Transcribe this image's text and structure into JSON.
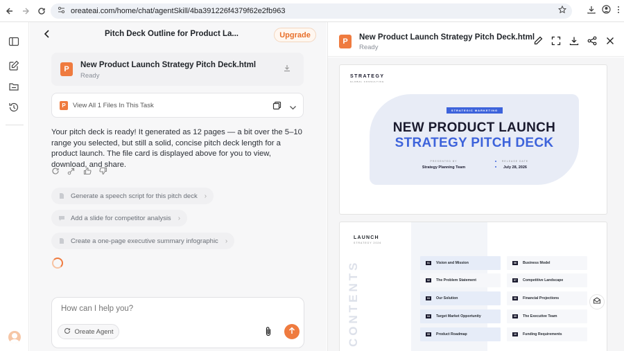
{
  "browser": {
    "url": "oreateai.com/home/chat/agentSkill/4ba391226f4379f62e2fb963"
  },
  "chat": {
    "title": "Pitch Deck Outline for Product La...",
    "upgrade_label": "Upgrade",
    "file_card": {
      "icon_letter": "P",
      "name": "New Product Launch Strategy Pitch Deck.html",
      "status": "Ready"
    },
    "files_row": {
      "icon_letter": "P",
      "label": "View All 1 Files In This Task"
    },
    "message": "Your pitch deck is ready! It generated as 12 pages — a bit over the 5–10 range you selected, but still a solid, concise pitch deck length for a product launch. The file card is displayed above for you to view, download, and share.",
    "suggestions": [
      {
        "label": "Generate a speech script for this pitch deck"
      },
      {
        "label": "Add a slide for competitor analysis"
      },
      {
        "label": "Create a one-page executive summary infographic"
      }
    ],
    "input_placeholder": "How can I help you?",
    "agent_button": "Oreate Agent"
  },
  "preview": {
    "icon_letter": "P",
    "name": "New Product Launch Strategy Pitch Deck.html",
    "status": "Ready",
    "slide1": {
      "brand": "STRATEGY",
      "brand_sub": "GLOBAL CONSULTING",
      "tag": "STRATEGIC MARKETING",
      "title_line1": "NEW PRODUCT LAUNCH",
      "title_line2": "STRATEGY PITCH DECK",
      "presented_by_label": "PRESENTED BY",
      "presented_by": "Strategy Planning Team",
      "release_date_label": "RELEASE DATE",
      "release_date": "July 28, 2026"
    },
    "slide2": {
      "brand": "LAUNCH",
      "brand_sub": "STRATEGY 2026",
      "side_label": "CONTENTS",
      "toc_left": [
        {
          "num": "01",
          "label": "Vision and Mission"
        },
        {
          "num": "02",
          "label": "The Problem Statement"
        },
        {
          "num": "03",
          "label": "Our Solution"
        },
        {
          "num": "04",
          "label": "Target Market Opportunity"
        },
        {
          "num": "05",
          "label": "Product Roadmap"
        }
      ],
      "toc_right": [
        {
          "num": "06",
          "label": "Business Model"
        },
        {
          "num": "07",
          "label": "Competitive Landscape"
        },
        {
          "num": "08",
          "label": "Financial Projections"
        },
        {
          "num": "09",
          "label": "The Executive Team"
        },
        {
          "num": "10",
          "label": "Funding Requirements"
        }
      ]
    }
  },
  "colors": {
    "accent": "#ef7b3f",
    "deck_blue": "#3d63db",
    "deck_navy": "#1a1a2e"
  },
  "icons": [
    "back-arrow-icon",
    "forward-arrow-icon",
    "reload-icon",
    "site-info-icon",
    "star-icon",
    "download-icon",
    "profile-icon",
    "menu-dots-icon",
    "sidebar-toggle-icon",
    "new-chat-icon",
    "folder-icon",
    "history-icon",
    "chevron-left-icon",
    "ppt-file-icon",
    "copy-icon",
    "chevron-down-icon",
    "regenerate-icon",
    "share-icon",
    "thumbs-up-icon",
    "thumbs-down-icon",
    "document-icon",
    "chat-icon",
    "paperclip-icon",
    "send-arrow-icon",
    "edit-icon",
    "fullscreen-icon",
    "close-icon",
    "mail-icon"
  ]
}
